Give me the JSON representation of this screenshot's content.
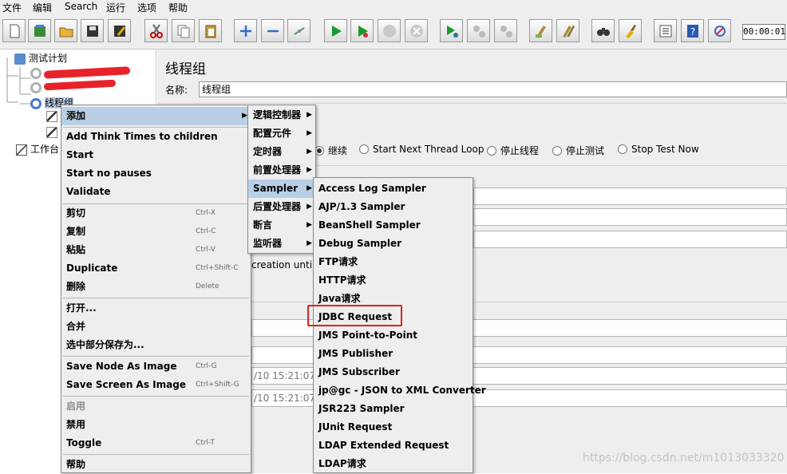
{
  "menubar": [
    "文件",
    "编辑",
    "Search",
    "运行",
    "选项",
    "帮助"
  ],
  "toolbar": {
    "buttons": [
      "new-icon",
      "templates-icon",
      "open-icon",
      "save-icon",
      "save-as-icon",
      "cut-icon",
      "copy-icon",
      "paste-icon",
      "expand-icon",
      "collapse-icon",
      "toggle-icon",
      "start-icon",
      "start-no-pause-icon",
      "stop-icon",
      "shutdown-icon",
      "remote-start-icon",
      "remote-stop-icon",
      "remote-shutdown-icon",
      "clear-icon",
      "clear-all-icon",
      "search-icon",
      "reset-search-icon",
      "function-helper-icon",
      "help-icon",
      "log-viewer-icon"
    ],
    "timer": "00:00:01"
  },
  "tree": {
    "test_plan": "测试计划",
    "thread_group": "线程组",
    "workbench": "工作台"
  },
  "panel": {
    "title": "线程组",
    "name_label": "名称:",
    "name_value": "线程组",
    "radio_continue": "继续",
    "radio_next_loop": "Start Next Thread Loop",
    "radio_stop_thread": "停止线程",
    "radio_stop_test": "停止测试",
    "radio_stop_now": "Stop Test Now",
    "partial_creation": "creation until n",
    "date1": "/10 15:21:07",
    "date2": "/10 15:21:07"
  },
  "context_menu": {
    "add": "添加",
    "think_times": "Add Think Times to children",
    "start": "Start",
    "start_no_pauses": "Start no pauses",
    "validate": "Validate",
    "cut": "剪切",
    "cut_sc": "Ctrl-X",
    "copy": "复制",
    "copy_sc": "Ctrl-C",
    "paste": "粘贴",
    "paste_sc": "Ctrl-V",
    "duplicate": "Duplicate",
    "duplicate_sc": "Ctrl+Shift-C",
    "delete": "删除",
    "delete_sc": "Delete",
    "open": "打开...",
    "merge": "合并",
    "save_selection": "选中部分保存为...",
    "save_node_image": "Save Node As Image",
    "save_node_image_sc": "Ctrl-G",
    "save_screen_image": "Save Screen As Image",
    "save_screen_image_sc": "Ctrl+Shift-G",
    "enable": "启用",
    "disable": "禁用",
    "toggle": "Toggle",
    "toggle_sc": "Ctrl-T",
    "help": "帮助"
  },
  "add_submenu": [
    "逻辑控制器",
    "配置元件",
    "定时器",
    "前置处理器",
    "Sampler",
    "后置处理器",
    "断言",
    "监听器"
  ],
  "sampler_submenu": [
    "Access Log Sampler",
    "AJP/1.3 Sampler",
    "BeanShell Sampler",
    "Debug Sampler",
    "FTP请求",
    "HTTP请求",
    "Java请求",
    "JDBC Request",
    "JMS Point-to-Point",
    "JMS Publisher",
    "JMS Subscriber",
    "jp@gc - JSON to XML Converter",
    "JSR223 Sampler",
    "JUnit Request",
    "LDAP Extended Request",
    "LDAP请求"
  ],
  "watermark": "https://blog.csdn.net/m1013033320",
  "colors": {
    "selection": "#b8cfe5",
    "highlight_box": "#e02020",
    "menu_bg": "#eeeeee"
  }
}
